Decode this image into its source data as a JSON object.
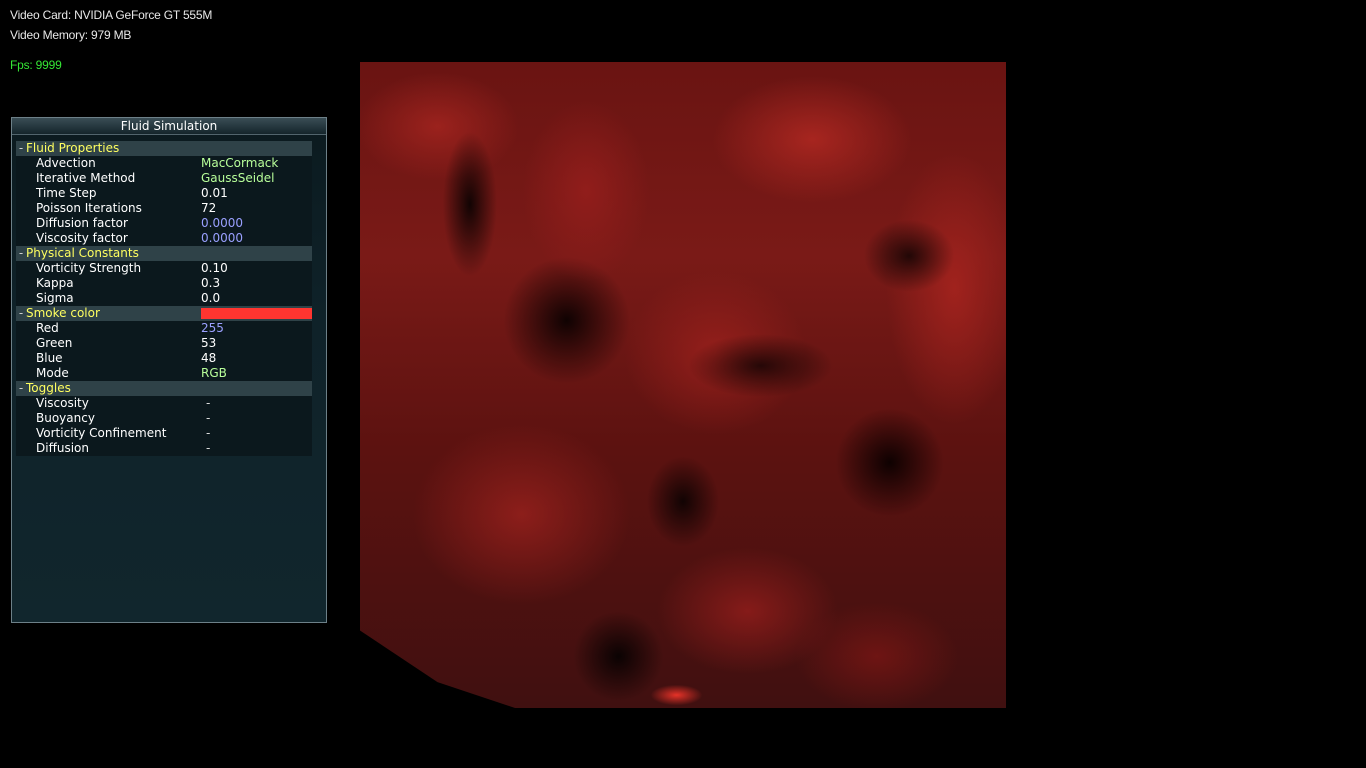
{
  "hud": {
    "video_card": "Video Card: NVIDIA GeForce GT 555M",
    "video_memory": "Video Memory: 979 MB",
    "fps": "Fps: 9999"
  },
  "panel": {
    "title": "Fluid Simulation",
    "groups": [
      {
        "label": "Fluid Properties",
        "sign": "-",
        "items": [
          {
            "label": "Advection",
            "value": "MacCormack",
            "kind": "string"
          },
          {
            "label": "Iterative Method",
            "value": "GaussSeidel",
            "kind": "string"
          },
          {
            "label": "Time Step",
            "value": "0.01",
            "kind": "number"
          },
          {
            "label": "Poisson Iterations",
            "value": "72",
            "kind": "number"
          },
          {
            "label": "Diffusion factor",
            "value": "0.0000",
            "kind": "readonly"
          },
          {
            "label": "Viscosity factor",
            "value": "0.0000",
            "kind": "readonly"
          }
        ]
      },
      {
        "label": "Physical Constants",
        "sign": "-",
        "items": [
          {
            "label": "Vorticity Strength",
            "value": "0.10",
            "kind": "number"
          },
          {
            "label": "Kappa",
            "value": "0.3",
            "kind": "number"
          },
          {
            "label": "Sigma",
            "value": "0.0",
            "kind": "number"
          }
        ]
      },
      {
        "label": "Smoke color",
        "sign": "-",
        "swatch_color": "#ff3530",
        "items": [
          {
            "label": "Red",
            "value": "255",
            "kind": "readonly"
          },
          {
            "label": "Green",
            "value": "53",
            "kind": "number"
          },
          {
            "label": "Blue",
            "value": "48",
            "kind": "number"
          },
          {
            "label": "Mode",
            "value": "RGB",
            "kind": "string"
          }
        ]
      },
      {
        "label": "Toggles",
        "sign": "-",
        "items": [
          {
            "label": "Viscosity",
            "value": "-",
            "kind": "toggle"
          },
          {
            "label": "Buoyancy",
            "value": "-",
            "kind": "toggle"
          },
          {
            "label": "Vorticity Confinement",
            "value": "-",
            "kind": "toggle"
          },
          {
            "label": "Diffusion",
            "value": "-",
            "kind": "toggle"
          }
        ]
      }
    ]
  },
  "colors": {
    "smoke": "#b02a24",
    "fps_text": "#35e635",
    "group_label": "#ffff60"
  }
}
